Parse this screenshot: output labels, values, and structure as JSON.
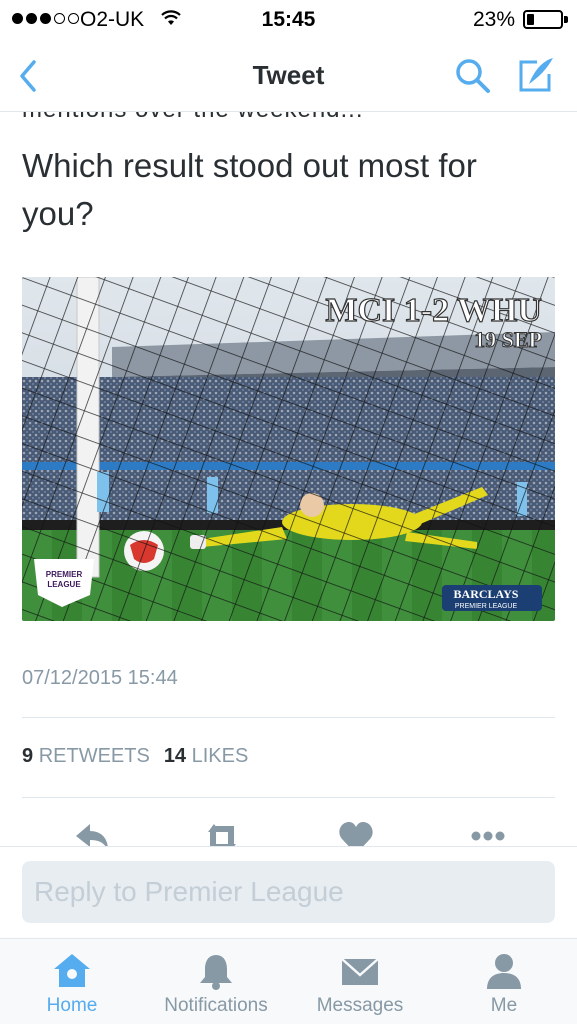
{
  "status_bar": {
    "carrier": "O2-UK",
    "time": "15:45",
    "battery_percent": "23%",
    "battery_level": 0.23,
    "signal_bars_filled": 3,
    "signal_bars_total": 5
  },
  "nav": {
    "title": "Tweet",
    "back_icon": "chevron-left-icon",
    "search_icon": "search-icon",
    "compose_icon": "compose-icon"
  },
  "tweet": {
    "text": "Which result stood out most for you?",
    "media": {
      "score_text": "MCI 1-2 WHU",
      "date_text": "19 SEP",
      "sponsor_line1": "BARCLAYS",
      "sponsor_line2": "PREMIER LEAGUE",
      "badge_line1": "PREMIER",
      "badge_line2": "LEAGUE"
    },
    "timestamp": "07/12/2015 15:44",
    "retweets_count": "9",
    "retweets_label": "RETWEETS",
    "likes_count": "14",
    "likes_label": "LIKES"
  },
  "actions": {
    "reply_icon": "reply-icon",
    "retweet_icon": "retweet-icon",
    "like_icon": "heart-icon",
    "more_icon": "more-icon"
  },
  "reply": {
    "placeholder": "Reply to Premier League"
  },
  "tabs": [
    {
      "label": "Home",
      "icon": "home-icon",
      "active": true
    },
    {
      "label": "Notifications",
      "icon": "bell-icon",
      "active": false
    },
    {
      "label": "Messages",
      "icon": "envelope-icon",
      "active": false
    },
    {
      "label": "Me",
      "icon": "person-icon",
      "active": false
    }
  ],
  "colors": {
    "accent": "#55acee",
    "text": "#292f33",
    "muted": "#8899a6",
    "divider": "#e1e8ed",
    "pitch": "#3a8a3a",
    "keeper_kit": "#e8e020"
  }
}
